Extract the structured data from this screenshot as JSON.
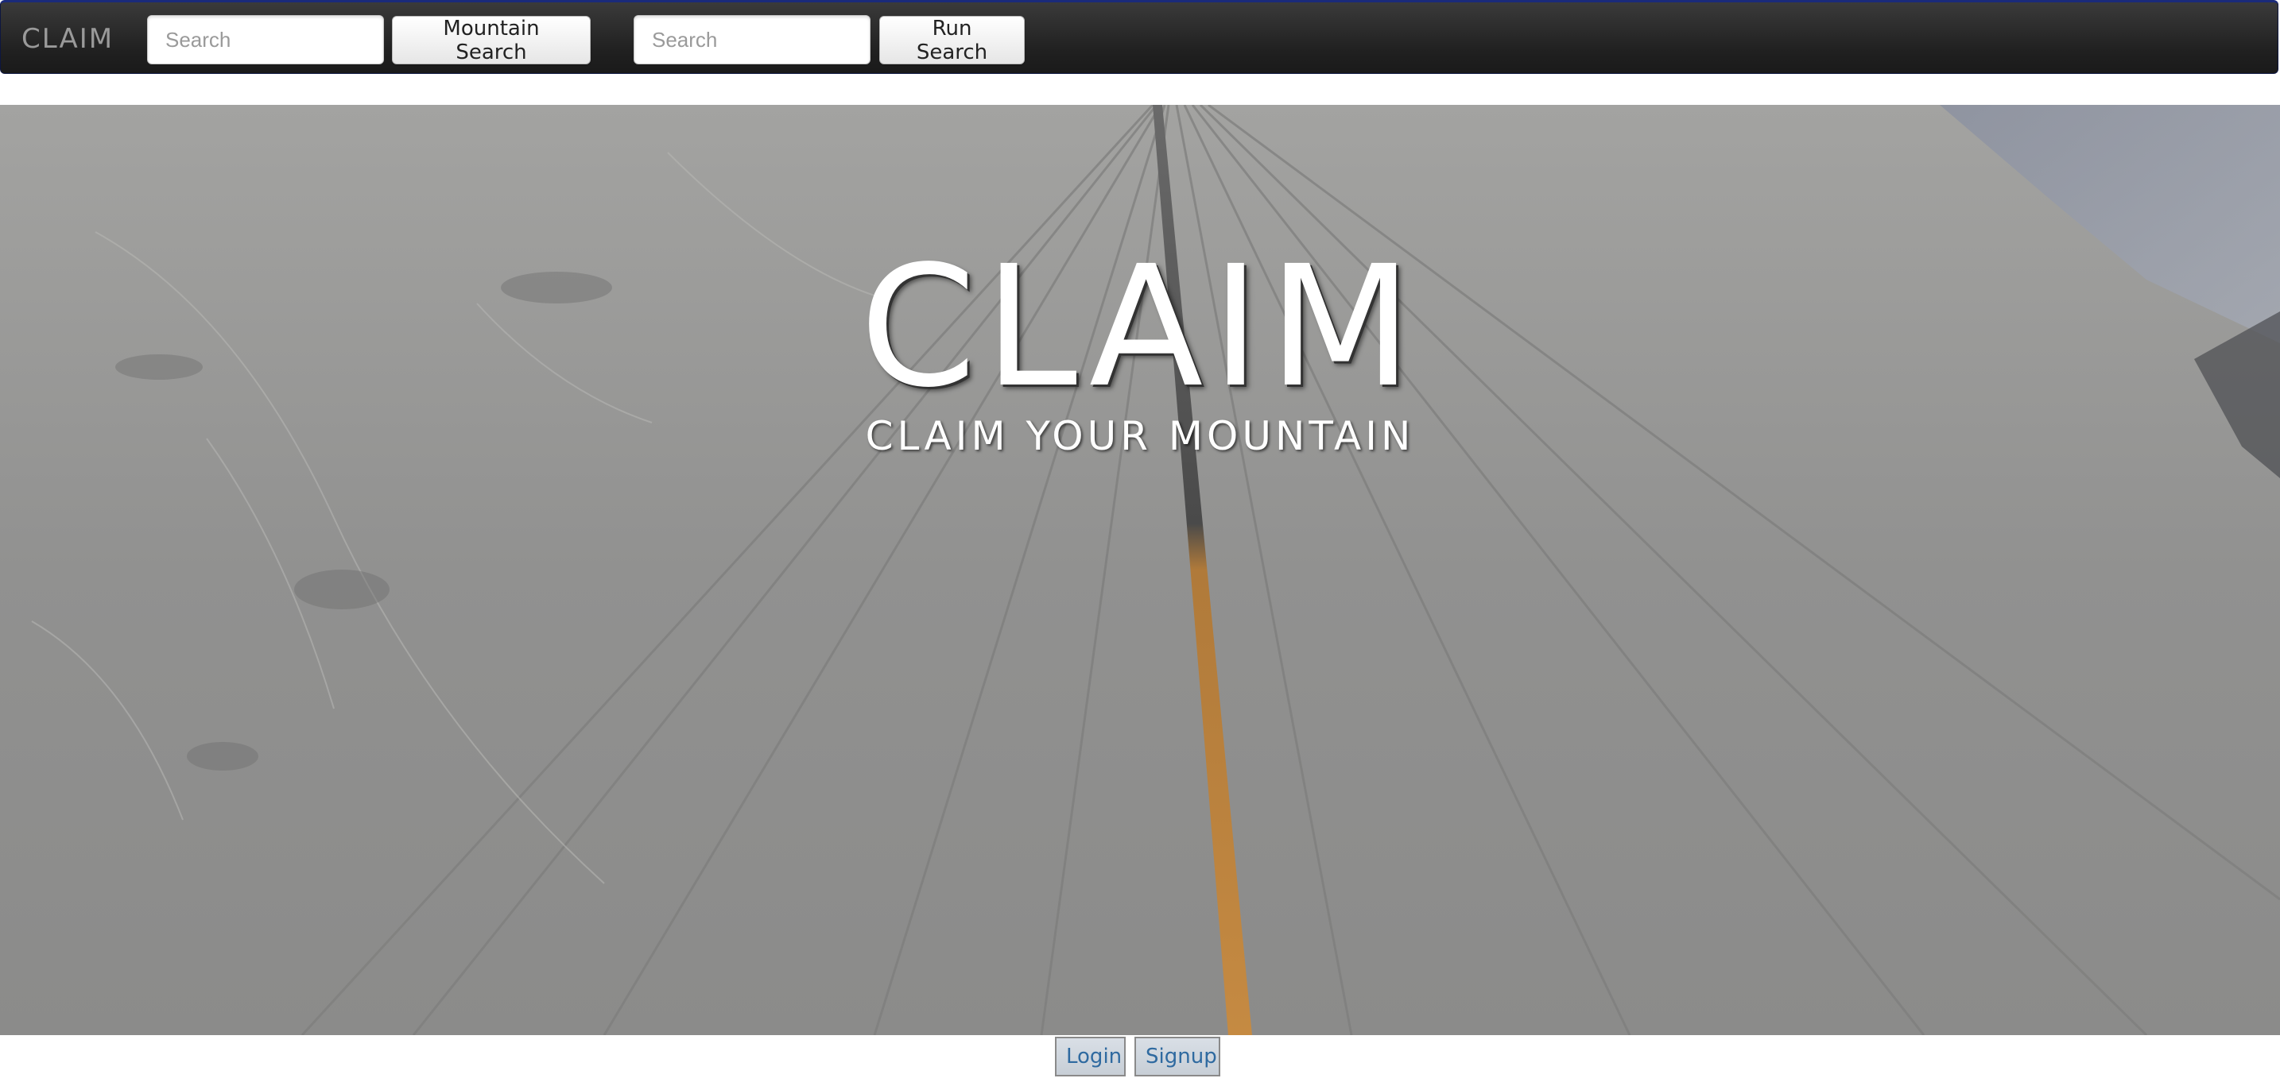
{
  "navbar": {
    "brand": "CLAIM",
    "mountain_search": {
      "placeholder": "Search",
      "button_label": "Mountain Search"
    },
    "run_search": {
      "placeholder": "Search",
      "button_label": "Run Search"
    }
  },
  "hero": {
    "title": "CLAIM",
    "subtitle": "CLAIM YOUR MOUNTAIN"
  },
  "auth": {
    "login_label": "Login",
    "signup_label": "Signup"
  },
  "colors": {
    "navbar_bg": "#262626",
    "link": "#2f6aa0"
  }
}
